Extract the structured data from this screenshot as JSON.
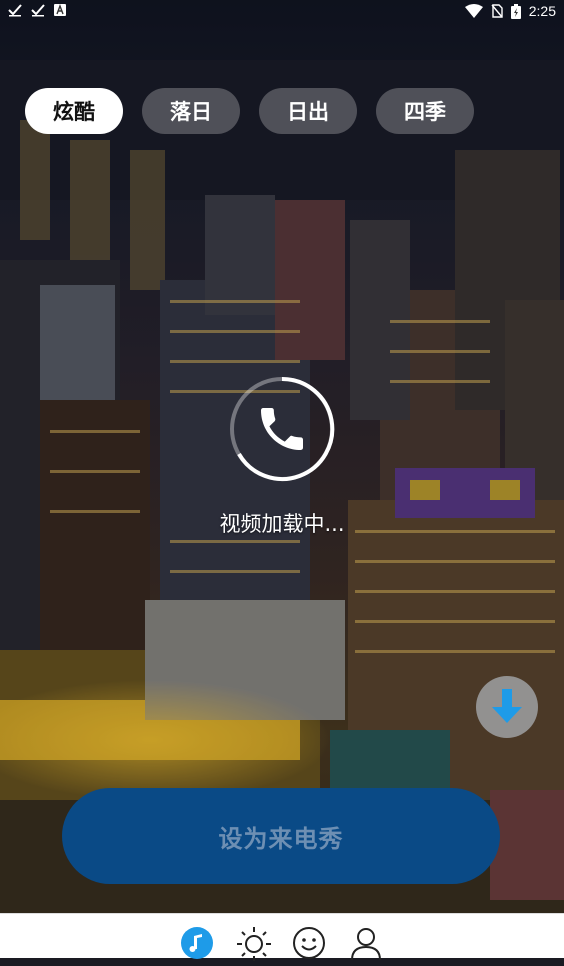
{
  "status_bar": {
    "time": "2:25",
    "left_icons": [
      "check-icon",
      "check-icon",
      "a-icon"
    ],
    "right_icons": [
      "wifi-icon",
      "no-sim-icon",
      "battery-icon"
    ]
  },
  "tabs": [
    {
      "label": "炫酷",
      "active": true
    },
    {
      "label": "落日",
      "active": false
    },
    {
      "label": "日出",
      "active": false
    },
    {
      "label": "四季",
      "active": false
    }
  ],
  "player": {
    "loading_text": "视频加载中...",
    "icon": "phone-icon"
  },
  "actions": {
    "download_icon": "download-icon",
    "set_button_label": "设为来电秀"
  },
  "bottom_nav": [
    {
      "icon": "music-note-icon",
      "active": true
    },
    {
      "icon": "sun-icon",
      "active": false
    },
    {
      "icon": "smiley-icon",
      "active": false
    },
    {
      "icon": "person-icon",
      "active": false
    }
  ],
  "colors": {
    "accent": "#1e9be8",
    "button_bg": "#0a4a86",
    "button_text": "#6d8fb3"
  }
}
